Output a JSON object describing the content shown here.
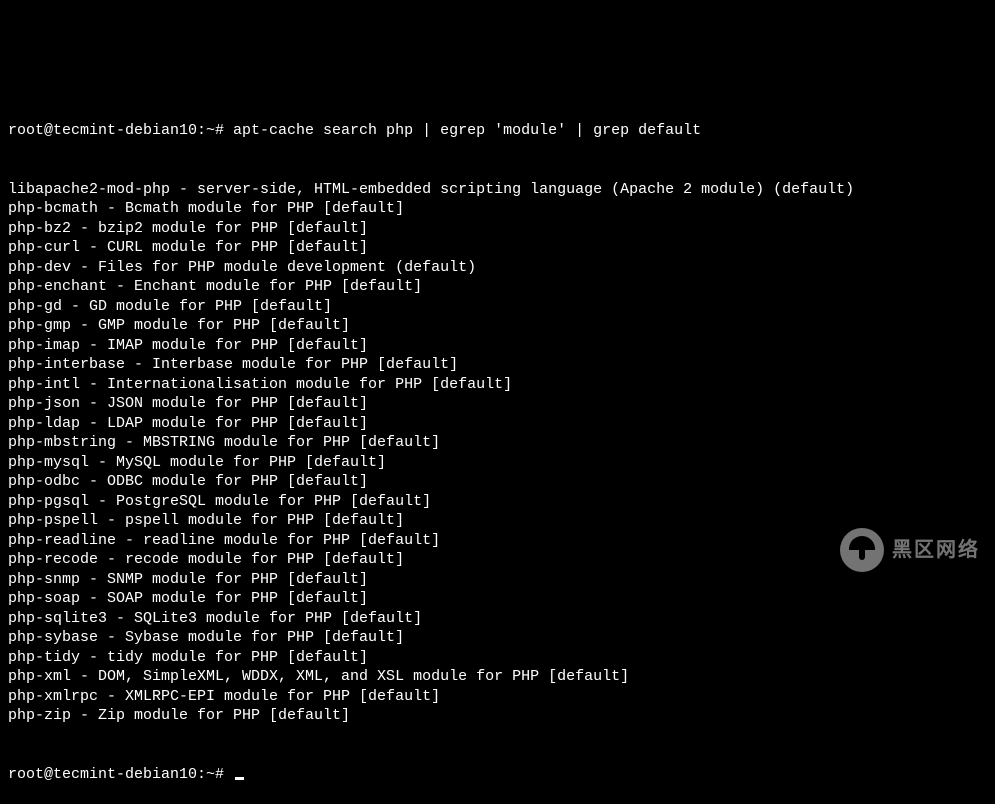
{
  "prompt1": {
    "full": "root@tecmint-debian10:~# apt-cache search php | egrep 'module' | grep default"
  },
  "output_lines": [
    "libapache2-mod-php - server-side, HTML-embedded scripting language (Apache 2 module) (default)",
    "php-bcmath - Bcmath module for PHP [default]",
    "php-bz2 - bzip2 module for PHP [default]",
    "php-curl - CURL module for PHP [default]",
    "php-dev - Files for PHP module development (default)",
    "php-enchant - Enchant module for PHP [default]",
    "php-gd - GD module for PHP [default]",
    "php-gmp - GMP module for PHP [default]",
    "php-imap - IMAP module for PHP [default]",
    "php-interbase - Interbase module for PHP [default]",
    "php-intl - Internationalisation module for PHP [default]",
    "php-json - JSON module for PHP [default]",
    "php-ldap - LDAP module for PHP [default]",
    "php-mbstring - MBSTRING module for PHP [default]",
    "php-mysql - MySQL module for PHP [default]",
    "php-odbc - ODBC module for PHP [default]",
    "php-pgsql - PostgreSQL module for PHP [default]",
    "php-pspell - pspell module for PHP [default]",
    "php-readline - readline module for PHP [default]",
    "php-recode - recode module for PHP [default]",
    "php-snmp - SNMP module for PHP [default]",
    "php-soap - SOAP module for PHP [default]",
    "php-sqlite3 - SQLite3 module for PHP [default]",
    "php-sybase - Sybase module for PHP [default]",
    "php-tidy - tidy module for PHP [default]",
    "php-xml - DOM, SimpleXML, WDDX, XML, and XSL module for PHP [default]",
    "php-xmlrpc - XMLRPC-EPI module for PHP [default]",
    "php-zip - Zip module for PHP [default]"
  ],
  "prompt2": {
    "full": "root@tecmint-debian10:~# "
  },
  "watermark": {
    "text": "黑区网络"
  }
}
